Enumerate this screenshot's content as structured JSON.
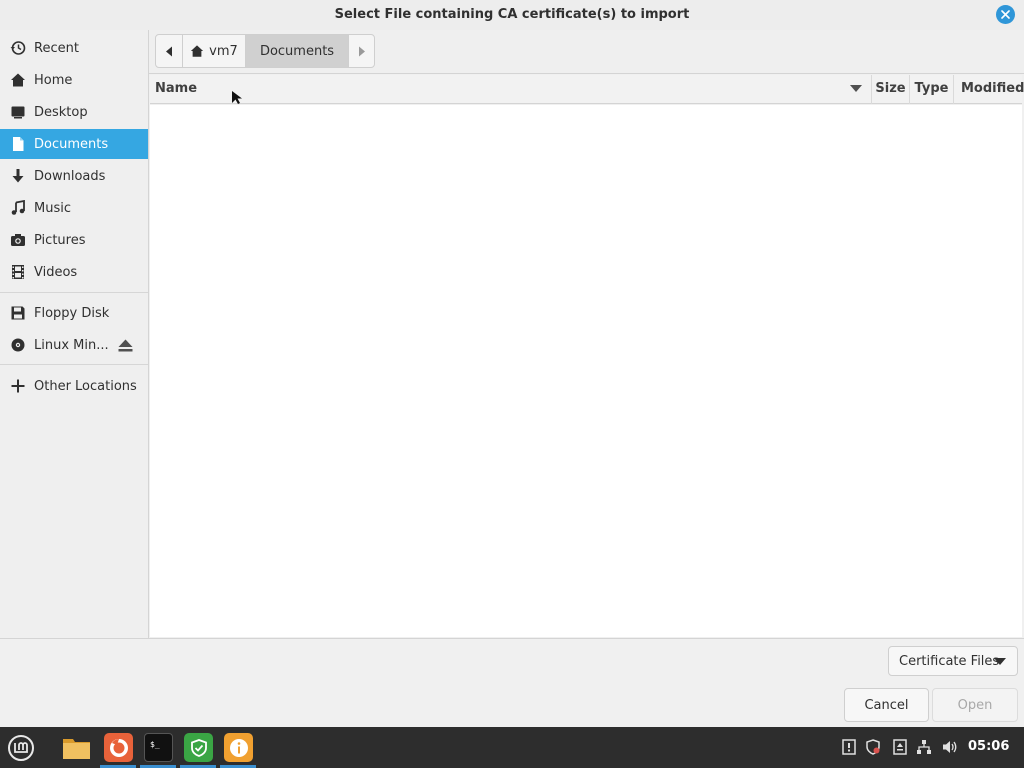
{
  "dialog": {
    "title": "Select File containing CA certificate(s) to import"
  },
  "sidebar": {
    "items": [
      {
        "label": "Recent",
        "icon": "recent-icon"
      },
      {
        "label": "Home",
        "icon": "home-icon"
      },
      {
        "label": "Desktop",
        "icon": "desktop-icon"
      },
      {
        "label": "Documents",
        "icon": "document-icon",
        "active": true
      },
      {
        "label": "Downloads",
        "icon": "download-icon"
      },
      {
        "label": "Music",
        "icon": "music-icon"
      },
      {
        "label": "Pictures",
        "icon": "camera-icon"
      },
      {
        "label": "Videos",
        "icon": "film-icon"
      },
      {
        "label": "Floppy Disk",
        "icon": "floppy-icon"
      },
      {
        "label": "Linux Min...",
        "icon": "disc-icon"
      },
      {
        "label": "Other Locations",
        "icon": "plus-icon"
      }
    ]
  },
  "pathbar": {
    "home_label": "vm7",
    "current_label": "Documents"
  },
  "columns": {
    "name": "Name",
    "size": "Size",
    "type": "Type",
    "modified": "Modified"
  },
  "footer": {
    "filter_label": "Certificate Files",
    "cancel_label": "Cancel",
    "open_label": "Open"
  },
  "taskbar": {
    "clock": "05:06",
    "apps": [
      "files-icon",
      "firefox-icon",
      "terminal-icon",
      "shield-icon",
      "info-icon"
    ]
  },
  "colors": {
    "accent": "#35a7e2",
    "close": "#2f96d8",
    "taskbar": "#2d2d2d"
  }
}
